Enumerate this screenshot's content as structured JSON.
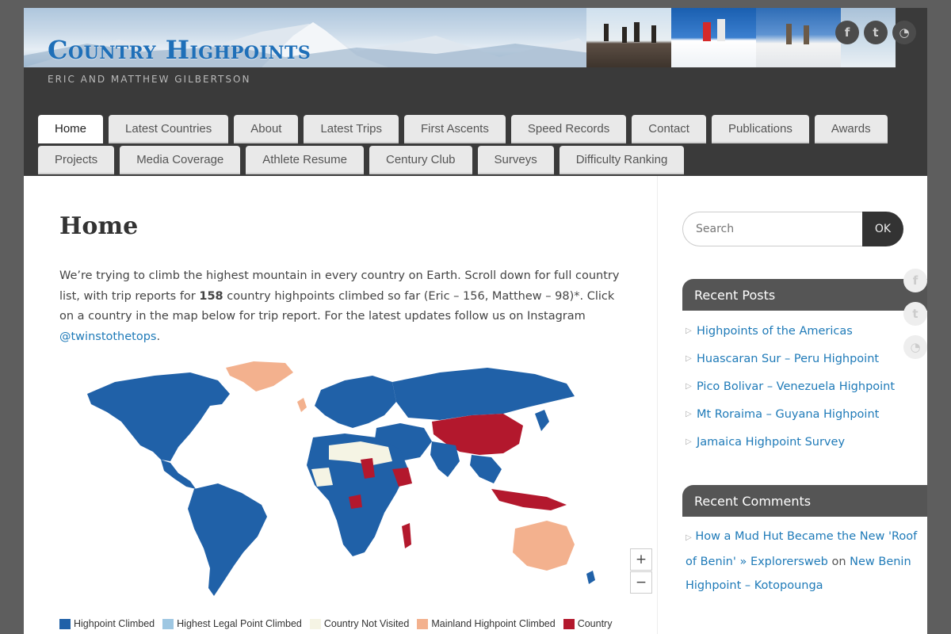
{
  "site": {
    "title": "Country Highpoints",
    "tagline": "ERIC AND MATTHEW GILBERTSON"
  },
  "social": {
    "facebook_glyph": "f",
    "twitter_glyph": "t",
    "rss_glyph": "◔"
  },
  "nav": {
    "row1": [
      "Home",
      "Latest Countries",
      "About",
      "Latest Trips",
      "First Ascents",
      "Speed Records",
      "Contact",
      "Publications",
      "Awards"
    ],
    "row2": [
      "Projects",
      "Media Coverage",
      "Athlete Resume",
      "Century Club",
      "Surveys",
      "Difficulty Ranking"
    ],
    "active": "Home"
  },
  "page": {
    "title": "Home",
    "intro_part1": "We’re trying to climb the highest mountain in every country on Earth. Scroll down for full country list, with trip reports for ",
    "intro_count": "158",
    "intro_part2": " country highpoints climbed so far (Eric – 156, Matthew – 98)*. Click on a country in the map below for trip report. For the latest updates follow us on Instagram ",
    "intro_link": "@twinstothetops",
    "intro_end": "."
  },
  "map": {
    "zoom_in": "+",
    "zoom_out": "−",
    "colors": {
      "climbed": "#2061a8",
      "legal": "#9ec7e2",
      "not_visited": "#f5f4e4",
      "mainland": "#f3b18e",
      "country": "#b3182d"
    },
    "legend": [
      "Highpoint Climbed",
      "Highest Legal Point Climbed",
      "Country Not Visited",
      "Mainland Highpoint Climbed",
      "Country"
    ]
  },
  "sidebar": {
    "search_placeholder": "Search",
    "search_button": "OK",
    "recent_posts_title": "Recent Posts",
    "recent_posts": [
      "Highpoints of the Americas",
      "Huascaran Sur – Peru Highpoint",
      "Pico Bolivar – Venezuela Highpoint",
      "Mt Roraima – Guyana Highpoint",
      "Jamaica Highpoint Survey"
    ],
    "recent_comments_title": "Recent Comments",
    "comment_link1": "How a Mud Hut Became the New 'Roof of Benin' » Explorersweb",
    "comment_on": " on ",
    "comment_link2": "New Benin Highpoint – Kotopounga"
  }
}
